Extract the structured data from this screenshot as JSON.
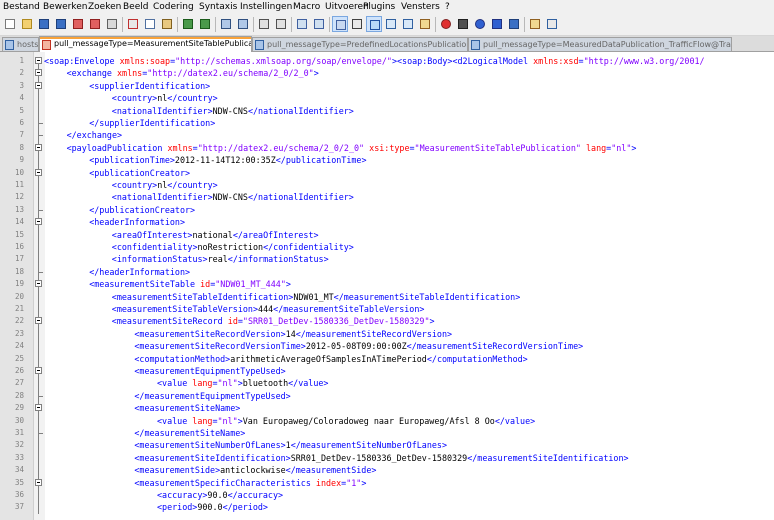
{
  "menu": [
    "Bestand",
    "Bewerken",
    "Zoeken",
    "Beeld",
    "Codering",
    "Syntaxis",
    "Instellingen",
    "Macro",
    "Uitvoeren",
    "Plugins",
    "Vensters",
    "?"
  ],
  "toolbar": [
    "new-file",
    "open-file",
    "save-file",
    "save-all",
    "close-file",
    "close-all",
    "print",
    "cut",
    "copy",
    "paste",
    "undo",
    "redo",
    "find",
    "replace",
    "zoom-in",
    "zoom-out",
    "sync-vertical",
    "sync-horizontal",
    "word-wrap",
    "show-all-chars",
    "indent-guide",
    "document-map",
    "function-list",
    "folder-workspace",
    "record-macro",
    "stop-recording",
    "play-macro",
    "play-multiple",
    "save-macro",
    "launch",
    "spell-check"
  ],
  "tabs": [
    {
      "label": "hosts",
      "active": false,
      "icon": "blue"
    },
    {
      "label": "pull_messageType=MeasurementSiteTablePublication.xml",
      "active": true,
      "icon": "red"
    },
    {
      "label": "pull_messageType=PredefinedLocationsPublication.xml",
      "active": false,
      "icon": "blue"
    },
    {
      "label": "pull_messageType=MeasuredDataPublication_TrafficFlow@TrafficSpeed.xml",
      "active": false,
      "icon": "blue"
    }
  ],
  "colors": {
    "tag": "#0000ff",
    "attr": "#ff0000",
    "value": "#8000ff",
    "text": "#000000",
    "tab_accent": "#f8a33a"
  },
  "lines": [
    {
      "n": "1",
      "indent": 0,
      "fold": "minus",
      "tokens": [
        [
          "t",
          "<soap:Envelope "
        ],
        [
          "a",
          "xmlns:soap"
        ],
        [
          "t",
          "="
        ],
        [
          "v",
          "\"http://schemas.xmlsoap.org/soap/envelope/\""
        ],
        [
          "t",
          "><soap:Body><d2LogicalModel "
        ],
        [
          "a",
          "xmlns:xsd"
        ],
        [
          "t",
          "="
        ],
        [
          "v",
          "\"http://www.w3.org/2001/"
        ]
      ]
    },
    {
      "n": "2",
      "indent": 1,
      "fold": "minus",
      "tokens": [
        [
          "t",
          "<exchange "
        ],
        [
          "a",
          "xmlns"
        ],
        [
          "t",
          "="
        ],
        [
          "v",
          "\"http://datex2.eu/schema/2_0/2_0\""
        ],
        [
          "t",
          ">"
        ]
      ]
    },
    {
      "n": "3",
      "indent": 2,
      "fold": "minus",
      "tokens": [
        [
          "t",
          "<supplierIdentification>"
        ]
      ]
    },
    {
      "n": "4",
      "indent": 3,
      "fold": "bar",
      "tokens": [
        [
          "t",
          "<country>"
        ],
        [
          "x",
          "nl"
        ],
        [
          "t",
          "</country>"
        ]
      ]
    },
    {
      "n": "5",
      "indent": 3,
      "fold": "bar",
      "tokens": [
        [
          "t",
          "<nationalIdentifier>"
        ],
        [
          "x",
          "NDW-CNS"
        ],
        [
          "t",
          "</nationalIdentifier>"
        ]
      ]
    },
    {
      "n": "6",
      "indent": 2,
      "fold": "end",
      "tokens": [
        [
          "t",
          "</supplierIdentification>"
        ]
      ]
    },
    {
      "n": "7",
      "indent": 1,
      "fold": "end",
      "tokens": [
        [
          "t",
          "</exchange>"
        ]
      ]
    },
    {
      "n": "8",
      "indent": 1,
      "fold": "minus",
      "tokens": [
        [
          "t",
          "<payloadPublication "
        ],
        [
          "a",
          "xmlns"
        ],
        [
          "t",
          "="
        ],
        [
          "v",
          "\"http://datex2.eu/schema/2_0/2_0\""
        ],
        [
          "t",
          " "
        ],
        [
          "a",
          "xsi:type"
        ],
        [
          "t",
          "="
        ],
        [
          "v",
          "\"MeasurementSiteTablePublication\""
        ],
        [
          "t",
          " "
        ],
        [
          "a",
          "lang"
        ],
        [
          "t",
          "="
        ],
        [
          "v",
          "\"nl\""
        ],
        [
          "t",
          ">"
        ]
      ]
    },
    {
      "n": "9",
      "indent": 2,
      "fold": "bar",
      "tokens": [
        [
          "t",
          "<publicationTime>"
        ],
        [
          "x",
          "2012-11-14T12:00:35Z"
        ],
        [
          "t",
          "</publicationTime>"
        ]
      ]
    },
    {
      "n": "10",
      "indent": 2,
      "fold": "minus",
      "tokens": [
        [
          "t",
          "<publicationCreator>"
        ]
      ]
    },
    {
      "n": "11",
      "indent": 3,
      "fold": "bar",
      "tokens": [
        [
          "t",
          "<country>"
        ],
        [
          "x",
          "nl"
        ],
        [
          "t",
          "</country>"
        ]
      ]
    },
    {
      "n": "12",
      "indent": 3,
      "fold": "bar",
      "tokens": [
        [
          "t",
          "<nationalIdentifier>"
        ],
        [
          "x",
          "NDW-CNS"
        ],
        [
          "t",
          "</nationalIdentifier>"
        ]
      ]
    },
    {
      "n": "13",
      "indent": 2,
      "fold": "end",
      "tokens": [
        [
          "t",
          "</publicationCreator>"
        ]
      ]
    },
    {
      "n": "14",
      "indent": 2,
      "fold": "minus",
      "tokens": [
        [
          "t",
          "<headerInformation>"
        ]
      ]
    },
    {
      "n": "15",
      "indent": 3,
      "fold": "bar",
      "tokens": [
        [
          "t",
          "<areaOfInterest>"
        ],
        [
          "x",
          "national"
        ],
        [
          "t",
          "</areaOfInterest>"
        ]
      ]
    },
    {
      "n": "16",
      "indent": 3,
      "fold": "bar",
      "tokens": [
        [
          "t",
          "<confidentiality>"
        ],
        [
          "x",
          "noRestriction"
        ],
        [
          "t",
          "</confidentiality>"
        ]
      ]
    },
    {
      "n": "17",
      "indent": 3,
      "fold": "bar",
      "tokens": [
        [
          "t",
          "<informationStatus>"
        ],
        [
          "x",
          "real"
        ],
        [
          "t",
          "</informationStatus>"
        ]
      ]
    },
    {
      "n": "18",
      "indent": 2,
      "fold": "end",
      "tokens": [
        [
          "t",
          "</headerInformation>"
        ]
      ]
    },
    {
      "n": "19",
      "indent": 2,
      "fold": "minus",
      "tokens": [
        [
          "t",
          "<measurementSiteTable "
        ],
        [
          "a",
          "id"
        ],
        [
          "t",
          "="
        ],
        [
          "v",
          "\"NDW01_MT_444\""
        ],
        [
          "t",
          ">"
        ]
      ]
    },
    {
      "n": "20",
      "indent": 3,
      "fold": "bar",
      "tokens": [
        [
          "t",
          "<measurementSiteTableIdentification>"
        ],
        [
          "x",
          "NDW01_MT"
        ],
        [
          "t",
          "</measurementSiteTableIdentification>"
        ]
      ]
    },
    {
      "n": "21",
      "indent": 3,
      "fold": "bar",
      "tokens": [
        [
          "t",
          "<measurementSiteTableVersion>"
        ],
        [
          "x",
          "444"
        ],
        [
          "t",
          "</measurementSiteTableVersion>"
        ]
      ]
    },
    {
      "n": "22",
      "indent": 3,
      "fold": "minus",
      "tokens": [
        [
          "t",
          "<measurementSiteRecord "
        ],
        [
          "a",
          "id"
        ],
        [
          "t",
          "="
        ],
        [
          "v",
          "\"SRR01_DetDev-1580336_DetDev-1580329\""
        ],
        [
          "t",
          ">"
        ]
      ]
    },
    {
      "n": "23",
      "indent": 4,
      "fold": "bar",
      "tokens": [
        [
          "t",
          "<measurementSiteRecordVersion>"
        ],
        [
          "x",
          "14"
        ],
        [
          "t",
          "</measurementSiteRecordVersion>"
        ]
      ]
    },
    {
      "n": "24",
      "indent": 4,
      "fold": "bar",
      "tokens": [
        [
          "t",
          "<measurementSiteRecordVersionTime>"
        ],
        [
          "x",
          "2012-05-08T09:00:00Z"
        ],
        [
          "t",
          "</measurementSiteRecordVersionTime>"
        ]
      ]
    },
    {
      "n": "25",
      "indent": 4,
      "fold": "bar",
      "tokens": [
        [
          "t",
          "<computationMethod>"
        ],
        [
          "x",
          "arithmeticAverageOfSamplesInATimePeriod"
        ],
        [
          "t",
          "</computationMethod>"
        ]
      ]
    },
    {
      "n": "26",
      "indent": 4,
      "fold": "minus",
      "tokens": [
        [
          "t",
          "<measurementEquipmentTypeUsed>"
        ]
      ]
    },
    {
      "n": "27",
      "indent": 5,
      "fold": "bar",
      "tokens": [
        [
          "t",
          "<value "
        ],
        [
          "a",
          "lang"
        ],
        [
          "t",
          "="
        ],
        [
          "v",
          "\"nl\""
        ],
        [
          "t",
          ">"
        ],
        [
          "x",
          "bluetooth"
        ],
        [
          "t",
          "</value>"
        ]
      ]
    },
    {
      "n": "28",
      "indent": 4,
      "fold": "end",
      "tokens": [
        [
          "t",
          "</measurementEquipmentTypeUsed>"
        ]
      ]
    },
    {
      "n": "29",
      "indent": 4,
      "fold": "minus",
      "tokens": [
        [
          "t",
          "<measurementSiteName>"
        ]
      ]
    },
    {
      "n": "30",
      "indent": 5,
      "fold": "bar",
      "tokens": [
        [
          "t",
          "<value "
        ],
        [
          "a",
          "lang"
        ],
        [
          "t",
          "="
        ],
        [
          "v",
          "\"nl\""
        ],
        [
          "t",
          ">"
        ],
        [
          "x",
          "Van Europaweg/Coloradoweg naar Europaweg/Afsl 8 Oo"
        ],
        [
          "t",
          "</value>"
        ]
      ]
    },
    {
      "n": "31",
      "indent": 4,
      "fold": "end",
      "tokens": [
        [
          "t",
          "</measurementSiteName>"
        ]
      ]
    },
    {
      "n": "32",
      "indent": 4,
      "fold": "bar",
      "tokens": [
        [
          "t",
          "<measurementSiteNumberOfLanes>"
        ],
        [
          "x",
          "1"
        ],
        [
          "t",
          "</measurementSiteNumberOfLanes>"
        ]
      ]
    },
    {
      "n": "33",
      "indent": 4,
      "fold": "bar",
      "tokens": [
        [
          "t",
          "<measurementSiteIdentification>"
        ],
        [
          "x",
          "SRR01_DetDev-1580336_DetDev-1580329"
        ],
        [
          "t",
          "</measurementSiteIdentification>"
        ]
      ]
    },
    {
      "n": "34",
      "indent": 4,
      "fold": "bar",
      "tokens": [
        [
          "t",
          "<measurementSide>"
        ],
        [
          "x",
          "anticlockwise"
        ],
        [
          "t",
          "</measurementSide>"
        ]
      ]
    },
    {
      "n": "35",
      "indent": 4,
      "fold": "minus",
      "tokens": [
        [
          "t",
          "<measurementSpecificCharacteristics "
        ],
        [
          "a",
          "index"
        ],
        [
          "t",
          "="
        ],
        [
          "v",
          "\"1\""
        ],
        [
          "t",
          ">"
        ]
      ]
    },
    {
      "n": "36",
      "indent": 5,
      "fold": "bar",
      "tokens": [
        [
          "t",
          "<accuracy>"
        ],
        [
          "x",
          "90.0"
        ],
        [
          "t",
          "</accuracy>"
        ]
      ]
    },
    {
      "n": "37",
      "indent": 5,
      "fold": "bar",
      "tokens": [
        [
          "t",
          "<period>"
        ],
        [
          "x",
          "900.0"
        ],
        [
          "t",
          "</period>"
        ]
      ]
    }
  ]
}
